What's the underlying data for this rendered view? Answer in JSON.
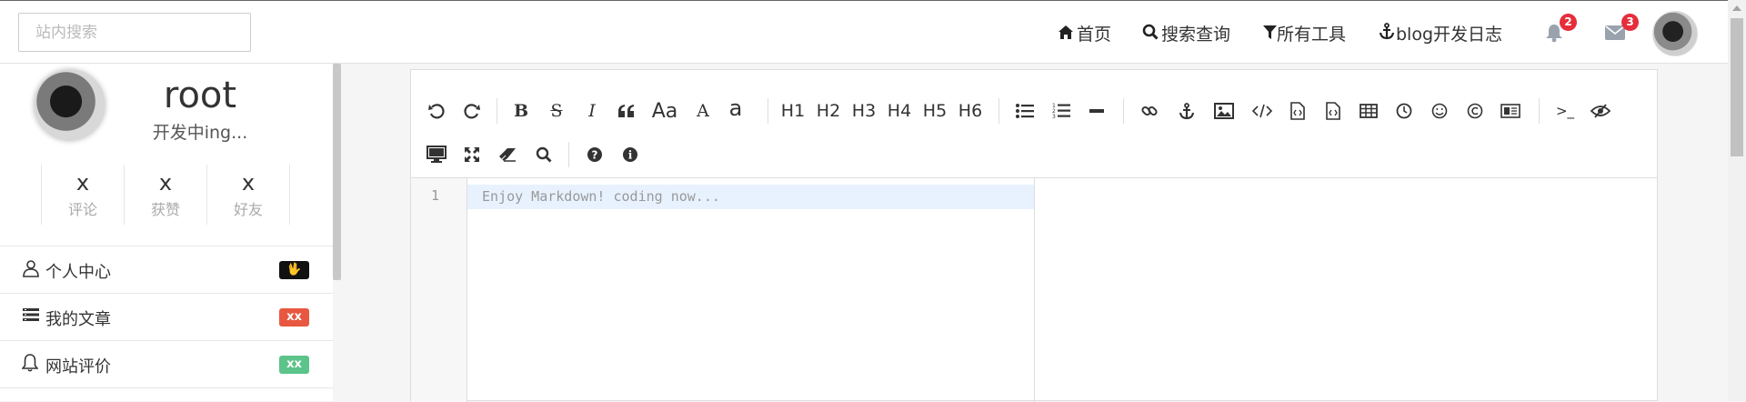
{
  "header": {
    "search_placeholder": "站内搜索",
    "nav": [
      {
        "icon": "home-icon",
        "glyph": "⌂",
        "label": "首页"
      },
      {
        "icon": "search-icon",
        "glyph": "⚲",
        "label": "搜索查询"
      },
      {
        "icon": "filter-icon",
        "glyph": "▼",
        "label": "所有工具"
      },
      {
        "icon": "anchor-icon",
        "glyph": "⚓",
        "label": "blog开发日志"
      }
    ],
    "notifications_count": "2",
    "messages_count": "3"
  },
  "profile": {
    "username": "root",
    "subtitle": "开发中ing...",
    "stats": [
      {
        "value": "x",
        "label": "评论"
      },
      {
        "value": "x",
        "label": "获赞"
      },
      {
        "value": "x",
        "label": "好友"
      }
    ]
  },
  "menu": [
    {
      "icon": "user-icon",
      "label": "个人中心",
      "tag": "🖖",
      "tag_color": "#111111"
    },
    {
      "icon": "list-icon",
      "label": "我的文章",
      "tag": "xx",
      "tag_color": "#e8573f"
    },
    {
      "icon": "bell-icon",
      "label": "网站评价",
      "tag": "xx",
      "tag_color": "#5cc38a"
    }
  ],
  "editor": {
    "line_number": "1",
    "placeholder": "Enjoy Markdown! coding now...",
    "toolbar_text": {
      "aa": "Aa",
      "a_upper": "A",
      "a_lower": "a",
      "h1": "H1",
      "h2": "H2",
      "h3": "H3",
      "h4": "H4",
      "h5": "H5",
      "h6": "H6",
      "bold": "B",
      "italic": "I",
      "strike": "S",
      "terminal": ">_"
    }
  },
  "colors": {
    "badge": "#e62d3b",
    "active_line": "#e8f2ff"
  }
}
